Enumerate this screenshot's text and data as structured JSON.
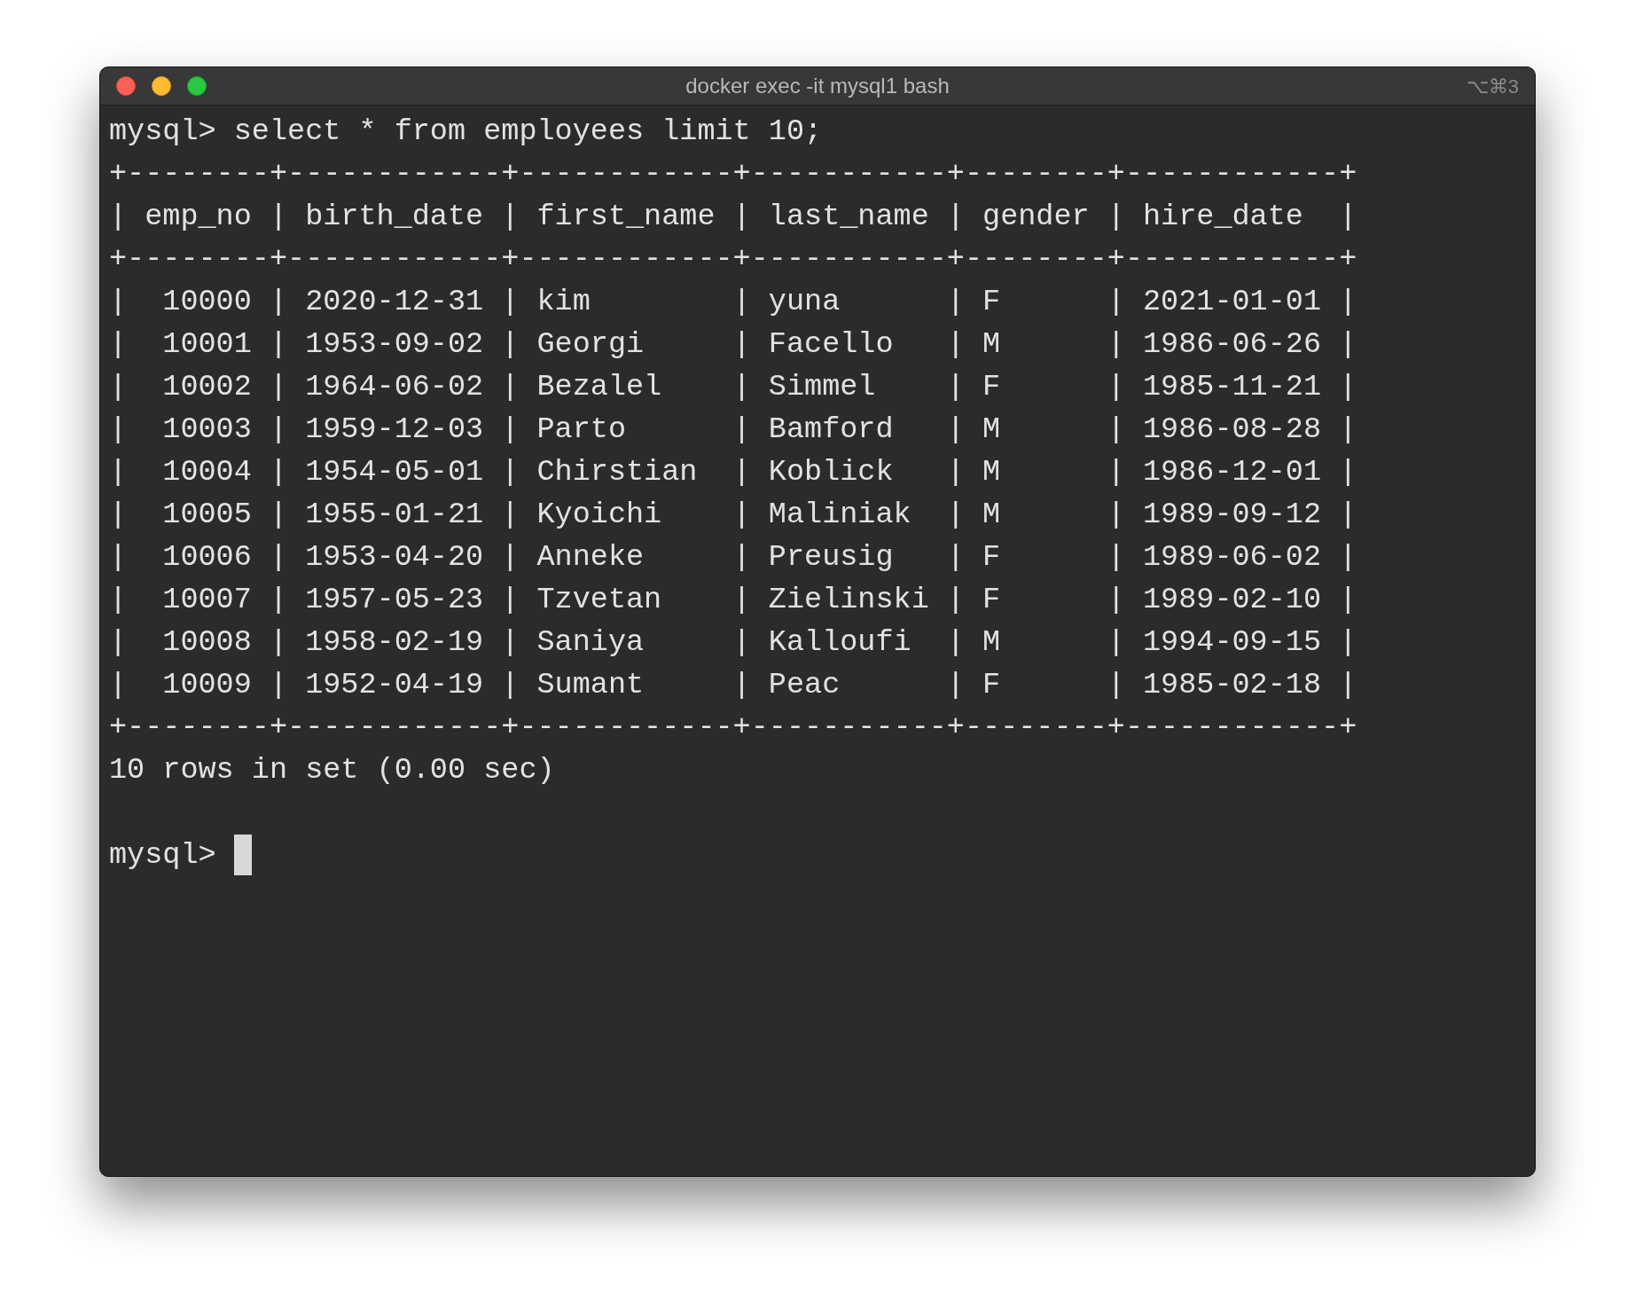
{
  "window": {
    "title": "docker exec -it mysql1 bash",
    "shortcut": "⌥⌘3"
  },
  "terminal": {
    "lines": [
      "mysql> select * from employees limit 10;",
      "+--------+------------+------------+-----------+--------+------------+",
      "| emp_no | birth_date | first_name | last_name | gender | hire_date  |",
      "+--------+------------+------------+-----------+--------+------------+",
      "|  10000 | 2020-12-31 | kim        | yuna      | F      | 2021-01-01 |",
      "|  10001 | 1953-09-02 | Georgi     | Facello   | M      | 1986-06-26 |",
      "|  10002 | 1964-06-02 | Bezalel    | Simmel    | F      | 1985-11-21 |",
      "|  10003 | 1959-12-03 | Parto      | Bamford   | M      | 1986-08-28 |",
      "|  10004 | 1954-05-01 | Chirstian  | Koblick   | M      | 1986-12-01 |",
      "|  10005 | 1955-01-21 | Kyoichi    | Maliniak  | M      | 1989-09-12 |",
      "|  10006 | 1953-04-20 | Anneke     | Preusig   | F      | 1989-06-02 |",
      "|  10007 | 1957-05-23 | Tzvetan    | Zielinski | F      | 1989-02-10 |",
      "|  10008 | 1958-02-19 | Saniya     | Kalloufi  | M      | 1994-09-15 |",
      "|  10009 | 1952-04-19 | Sumant     | Peac      | F      | 1985-02-18 |",
      "+--------+------------+------------+-----------+--------+------------+",
      "10 rows in set (0.00 sec)"
    ],
    "prompt": "mysql>"
  }
}
